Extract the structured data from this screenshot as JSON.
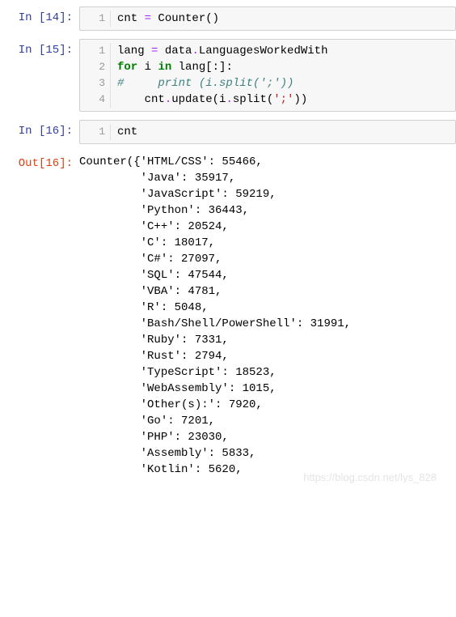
{
  "cells": [
    {
      "promptIn": "In [14]:",
      "lines": [
        {
          "n": "1",
          "html": "cnt <span class=\"op\">=</span> Counter()"
        }
      ]
    },
    {
      "promptIn": "In [15]:",
      "lines": [
        {
          "n": "1",
          "html": "lang <span class=\"op\">=</span> data<span class=\"op\">.</span>LanguagesWorkedWith"
        },
        {
          "n": "2",
          "html": "<span class=\"kw\">for</span> i <span class=\"kw\">in</span> lang[:]:"
        },
        {
          "n": "3",
          "html": "<span class=\"comment\">#     print (i.split(';'))</span>"
        },
        {
          "n": "4",
          "html": "    cnt<span class=\"op\">.</span>update(i<span class=\"op\">.</span>split(<span class=\"str\">';'</span>))"
        }
      ]
    },
    {
      "promptIn": "In [16]:",
      "lines": [
        {
          "n": "1",
          "html": "cnt"
        }
      ],
      "promptOut": "Out[16]:",
      "outputFirst": "Counter({'HTML/CSS': 55466,",
      "outputIndent": "         ",
      "outputRest": [
        "'Java': 35917,",
        "'JavaScript': 59219,",
        "'Python': 36443,",
        "'C++': 20524,",
        "'C': 18017,",
        "'C#': 27097,",
        "'SQL': 47544,",
        "'VBA': 4781,",
        "'R': 5048,",
        "'Bash/Shell/PowerShell': 31991,",
        "'Ruby': 7331,",
        "'Rust': 2794,",
        "'TypeScript': 18523,",
        "'WebAssembly': 1015,",
        "'Other(s):': 7920,",
        "'Go': 7201,",
        "'PHP': 23030,",
        "'Assembly': 5833,",
        "'Kotlin': 5620,"
      ]
    }
  ],
  "watermark": "https://blog.csdn.net/lys_828"
}
